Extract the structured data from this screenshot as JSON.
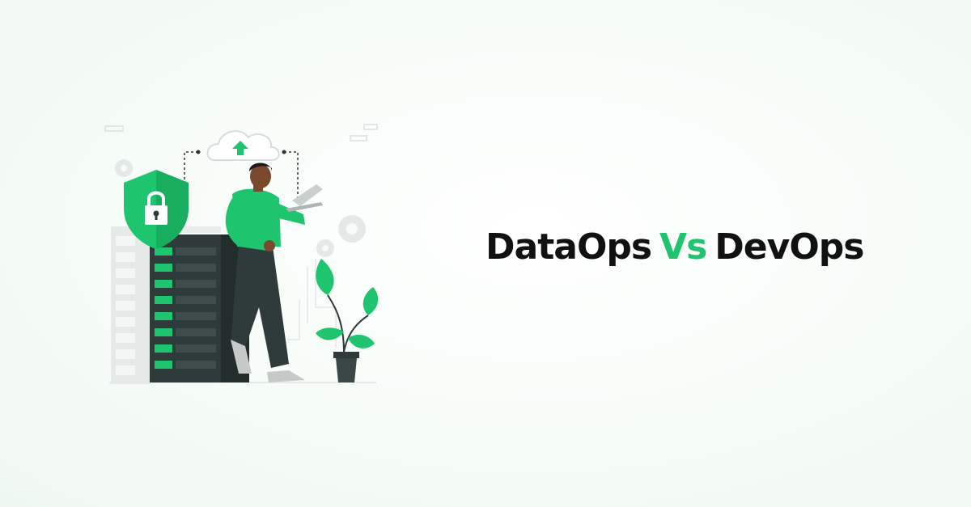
{
  "title": {
    "part1": "DataOps",
    "vs": "Vs",
    "part2": "DevOps"
  },
  "colors": {
    "accent": "#1fc46e",
    "dark": "#2f3b3a",
    "text": "#111111"
  },
  "illustration": {
    "icons": [
      "security-shield-icon",
      "padlock-icon",
      "cloud-upload-icon",
      "server-rack",
      "laptop-icon",
      "gear-icon",
      "potted-plant"
    ]
  }
}
